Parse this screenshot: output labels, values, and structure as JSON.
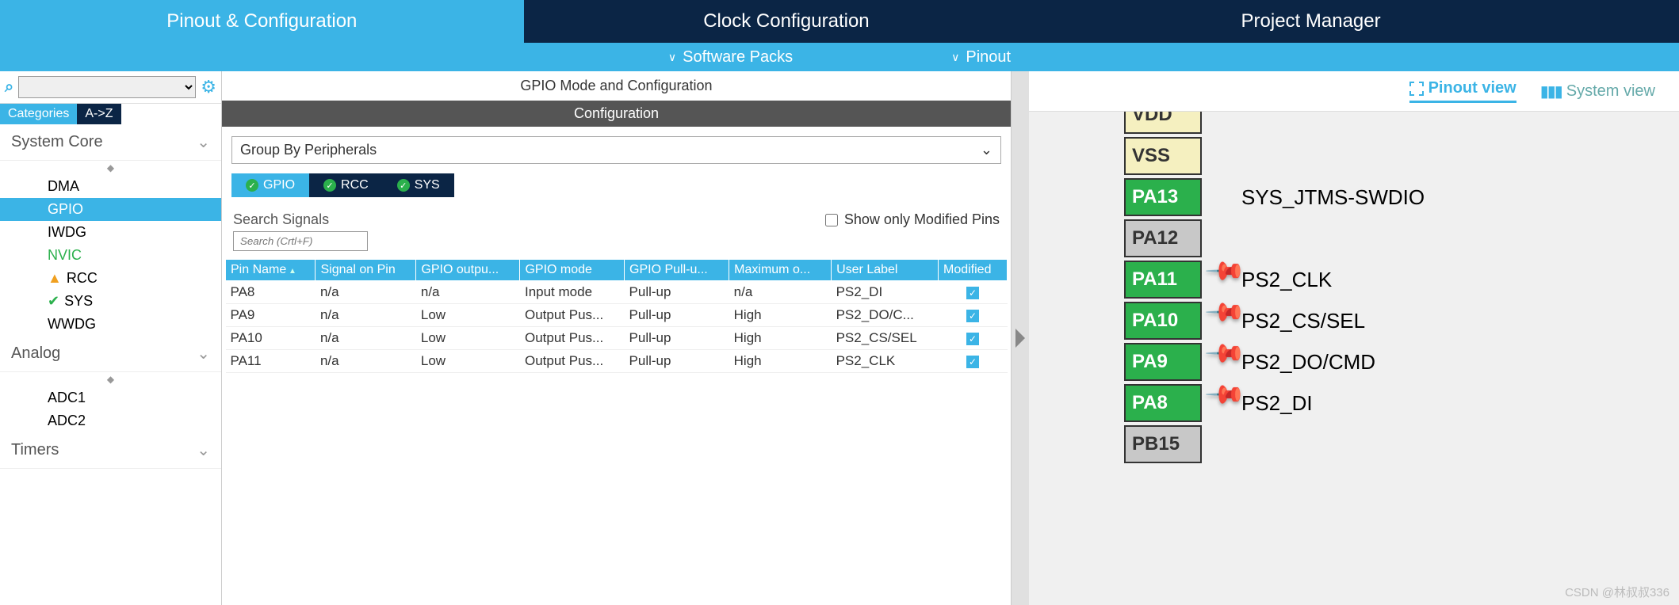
{
  "tabs": {
    "pinout": "Pinout & Configuration",
    "clock": "Clock Configuration",
    "project": "Project Manager"
  },
  "subbar": {
    "packs": "Software Packs",
    "pinout": "Pinout"
  },
  "left": {
    "cat": "Categories",
    "az": "A->Z",
    "sections": {
      "core": "System Core",
      "analog": "Analog",
      "timers": "Timers"
    },
    "core_items": [
      "DMA",
      "GPIO",
      "IWDG",
      "NVIC",
      "RCC",
      "SYS",
      "WWDG"
    ],
    "analog_items": [
      "ADC1",
      "ADC2"
    ]
  },
  "mid": {
    "title": "GPIO Mode and Configuration",
    "config": "Configuration",
    "group": "Group By Peripherals",
    "ptabs": {
      "gpio": "GPIO",
      "rcc": "RCC",
      "sys": "SYS"
    },
    "search_label": "Search Signals",
    "search_ph": "Search (Crtl+F)",
    "show_mod": "Show only Modified Pins",
    "cols": {
      "pin": "Pin Name",
      "sig": "Signal on Pin",
      "out": "GPIO outpu...",
      "mode": "GPIO mode",
      "pull": "GPIO Pull-u...",
      "max": "Maximum o...",
      "label": "User Label",
      "mod": "Modified"
    },
    "rows": [
      {
        "pin": "PA8",
        "sig": "n/a",
        "out": "n/a",
        "mode": "Input mode",
        "pull": "Pull-up",
        "max": "n/a",
        "label": "PS2_DI"
      },
      {
        "pin": "PA9",
        "sig": "n/a",
        "out": "Low",
        "mode": "Output Pus...",
        "pull": "Pull-up",
        "max": "High",
        "label": "PS2_DO/C..."
      },
      {
        "pin": "PA10",
        "sig": "n/a",
        "out": "Low",
        "mode": "Output Pus...",
        "pull": "Pull-up",
        "max": "High",
        "label": "PS2_CS/SEL"
      },
      {
        "pin": "PA11",
        "sig": "n/a",
        "out": "Low",
        "mode": "Output Pus...",
        "pull": "Pull-up",
        "max": "High",
        "label": "PS2_CLK"
      }
    ]
  },
  "right": {
    "pinout_view": "Pinout view",
    "system_view": "System view",
    "pins": [
      {
        "name": "VDD",
        "cls": "khaki",
        "label": "",
        "pin": false,
        "off": true
      },
      {
        "name": "VSS",
        "cls": "khaki",
        "label": "",
        "pin": false
      },
      {
        "name": "PA13",
        "cls": "green",
        "label": "SYS_JTMS-SWDIO",
        "pin": false
      },
      {
        "name": "PA12",
        "cls": "gray",
        "label": "",
        "pin": false
      },
      {
        "name": "PA11",
        "cls": "green",
        "label": "PS2_CLK",
        "pin": true
      },
      {
        "name": "PA10",
        "cls": "green",
        "label": "PS2_CS/SEL",
        "pin": true
      },
      {
        "name": "PA9",
        "cls": "green",
        "label": "PS2_DO/CMD",
        "pin": true
      },
      {
        "name": "PA8",
        "cls": "green",
        "label": "PS2_DI",
        "pin": true
      },
      {
        "name": "PB15",
        "cls": "gray",
        "label": "",
        "pin": false
      }
    ]
  },
  "watermark": "CSDN @林叔叔336"
}
